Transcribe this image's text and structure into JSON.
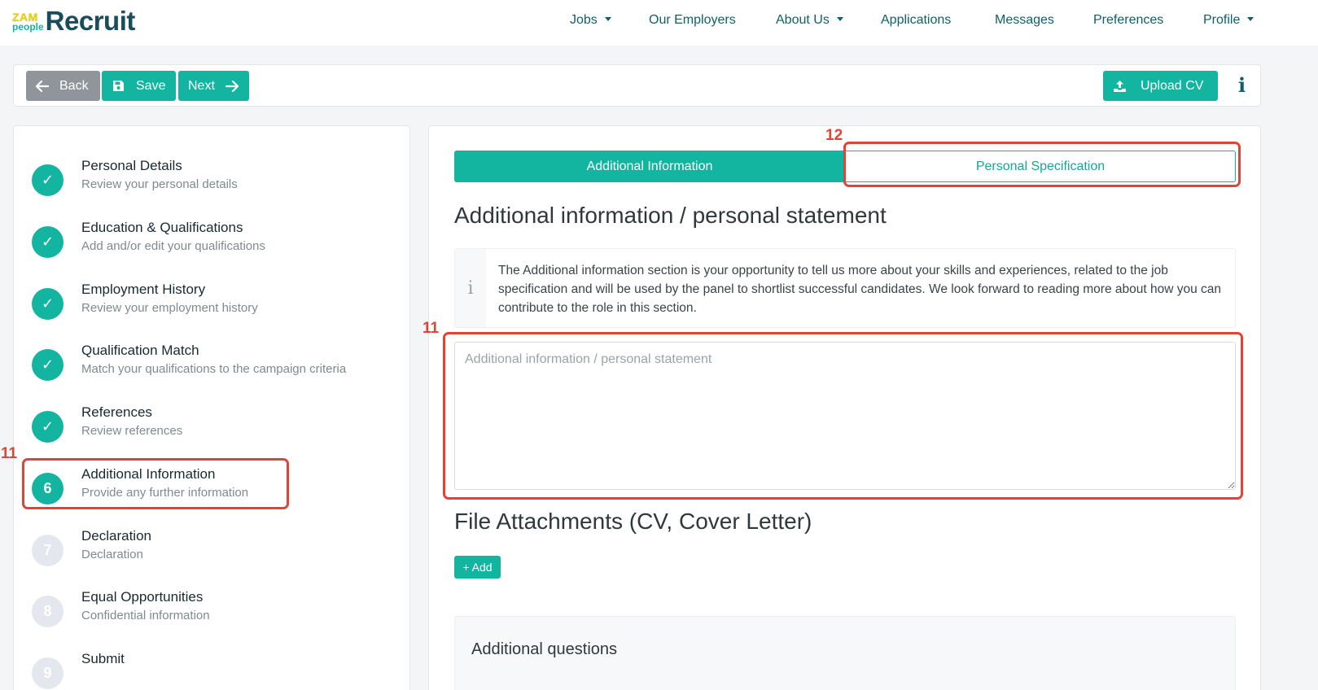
{
  "brand": {
    "logo_top": "ZAM",
    "logo_bottom": "people",
    "logo_word": "Recruit"
  },
  "nav": {
    "items": [
      {
        "label": "Jobs",
        "dropdown": true
      },
      {
        "label": "Our Employers",
        "dropdown": false
      },
      {
        "label": "About Us",
        "dropdown": true
      },
      {
        "label": "Applications",
        "dropdown": false
      },
      {
        "label": "Messages",
        "dropdown": false
      },
      {
        "label": "Preferences",
        "dropdown": false
      },
      {
        "label": "Profile",
        "dropdown": true
      }
    ]
  },
  "toolbar": {
    "back_label": "Back",
    "save_label": "Save",
    "next_label": "Next",
    "upload_label": "Upload CV",
    "info_glyph": "i"
  },
  "steps": [
    {
      "title": "Personal Details",
      "subtitle": "Review your personal details",
      "state": "done",
      "marker": "✓"
    },
    {
      "title": "Education & Qualifications",
      "subtitle": "Add and/or edit your qualifications",
      "state": "done",
      "marker": "✓"
    },
    {
      "title": "Employment History",
      "subtitle": "Review your employment history",
      "state": "done",
      "marker": "✓"
    },
    {
      "title": "Qualification Match",
      "subtitle": "Match your qualifications to the campaign criteria",
      "state": "done",
      "marker": "✓"
    },
    {
      "title": "References",
      "subtitle": "Review references",
      "state": "done",
      "marker": "✓"
    },
    {
      "title": "Additional Information",
      "subtitle": "Provide any further information",
      "state": "current",
      "marker": "6"
    },
    {
      "title": "Declaration",
      "subtitle": "Declaration",
      "state": "todo",
      "marker": "7"
    },
    {
      "title": "Equal Opportunities",
      "subtitle": "Confidential information",
      "state": "todo",
      "marker": "8"
    },
    {
      "title": "Submit",
      "subtitle": "",
      "state": "todo",
      "marker": "9"
    }
  ],
  "annotations": {
    "step_marker": "11",
    "textarea_marker": "11",
    "tab_marker": "12"
  },
  "main": {
    "tabs": [
      {
        "label": "Additional Information",
        "active": true
      },
      {
        "label": "Personal Specification",
        "active": false
      }
    ],
    "section_title": "Additional information / personal statement",
    "info_glyph": "i",
    "info_text": "The Additional information section is your opportunity to tell us more about your skills and experiences, related to the job specification and will be used by the panel to shortlist successful candidates. We look forward to reading more about how you can contribute to the role in this section.",
    "statement_placeholder": "Additional information / personal statement",
    "statement_value": "",
    "attachments_title": "File Attachments (CV, Cover Letter)",
    "add_label": "+ Add",
    "questions_title": "Additional questions"
  },
  "colors": {
    "accent": "#13b4a0",
    "brand_dark": "#1a4d5c",
    "annotation": "#e04434",
    "back_button": "#8f959b"
  },
  "icons": {
    "back": "arrow-left-icon",
    "save": "floppy-disk-icon",
    "next": "arrow-right-icon",
    "upload": "upload-icon",
    "step_done": "check-icon",
    "info": "info-icon"
  }
}
